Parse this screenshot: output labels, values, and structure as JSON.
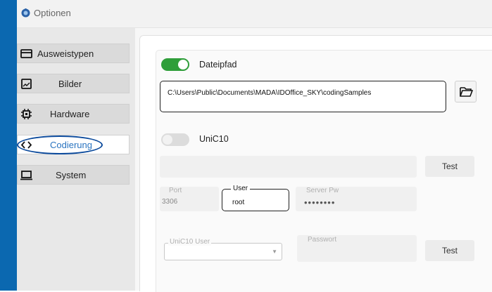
{
  "window": {
    "title": "Optionen"
  },
  "sidebar": {
    "items": [
      {
        "label": "Ausweistypen"
      },
      {
        "label": "Bilder"
      },
      {
        "label": "Hardware"
      },
      {
        "label": "Codierung"
      },
      {
        "label": "System"
      }
    ]
  },
  "dateipfad": {
    "label": "Dateipfad",
    "enabled": true,
    "path": "C:\\Users\\Public\\Documents\\MADA\\IDOffice_SKY\\codingSamples"
  },
  "unic10": {
    "label": "UniC10",
    "enabled": false,
    "test_label": "Test",
    "port_label": "Port",
    "port_value": "3306",
    "user_label": "User",
    "user_value": "root",
    "server_pw_label": "Server Pw",
    "server_pw_value": "••••••••",
    "unic10_user_label": "UniC10 User",
    "passwort_label": "Passwort",
    "test2_label": "Test"
  },
  "colors": {
    "accent_blue": "#0b68b0",
    "toggle_on": "#2f9e3a",
    "active_text": "#2a74c0"
  }
}
